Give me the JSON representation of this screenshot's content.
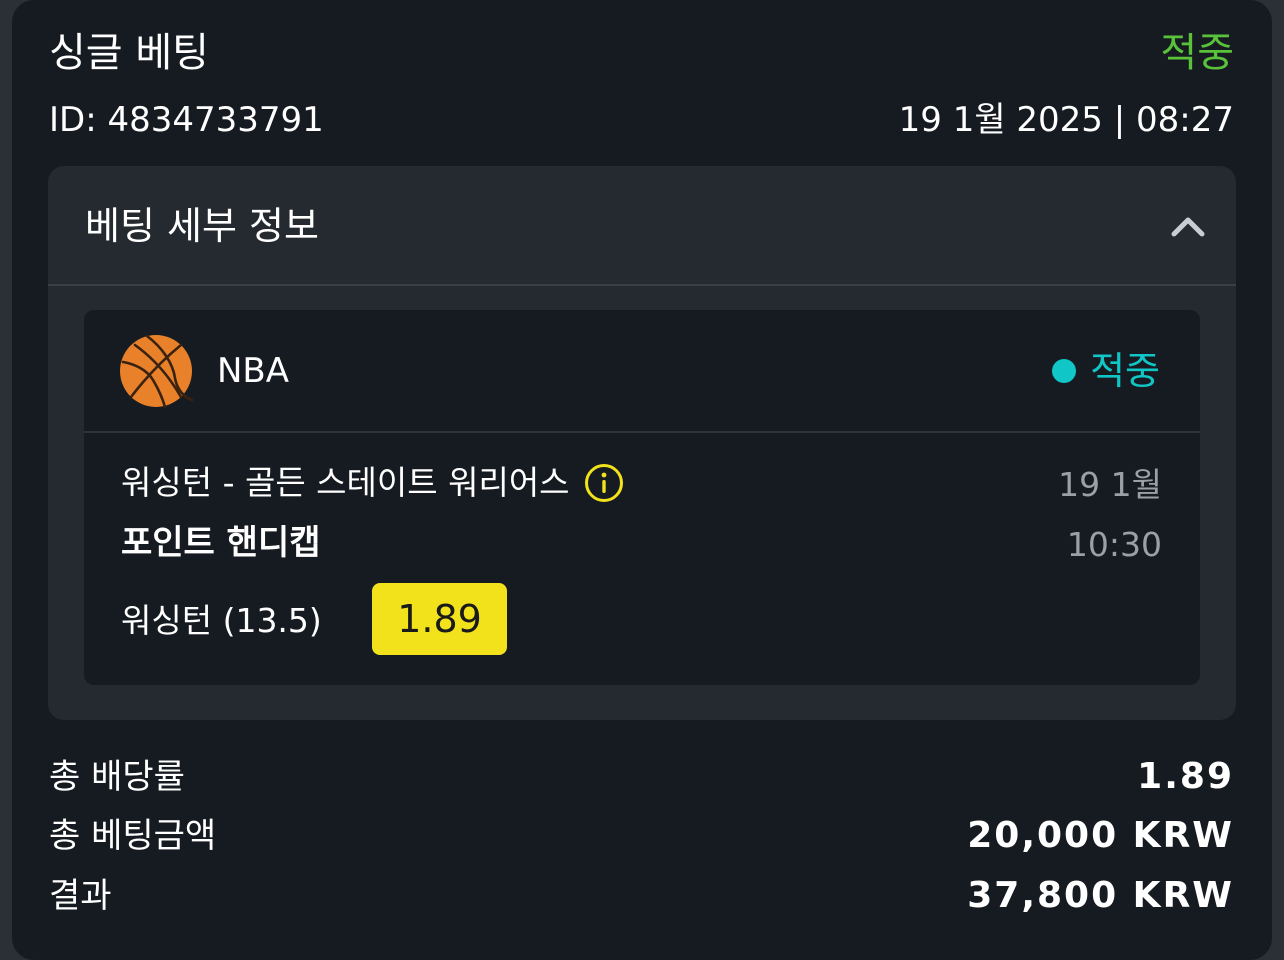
{
  "bet": {
    "type": "싱글 베팅",
    "status": "적중",
    "id_label": "ID: 4834733791",
    "datetime": "19 1월 2025 | 08:27"
  },
  "details": {
    "title": "베팅 세부 정보",
    "collapse_icon": "chevron-up-icon",
    "event": {
      "sport_icon": "basketball-icon",
      "league": "NBA",
      "status": "적중",
      "match": "워싱턴 - 골든 스테이트 워리어스",
      "info_icon": "info-icon",
      "date": "19 1월",
      "time": "10:30",
      "market": "포인트 핸디캡",
      "selection": "워싱턴 (13.5)",
      "odds": "1.89"
    }
  },
  "summary": {
    "total_odds_label": "총 배당률",
    "total_odds": "1.89",
    "total_stake_label": "총 베팅금액",
    "total_stake": "20,000 KRW",
    "result_label": "결과",
    "result": "37,800 KRW"
  },
  "colors": {
    "background": "#161b21",
    "panel": "#252a31",
    "win_green": "#59c13a",
    "win_teal": "#11c6c6",
    "odds_yellow": "#f2e21c"
  }
}
